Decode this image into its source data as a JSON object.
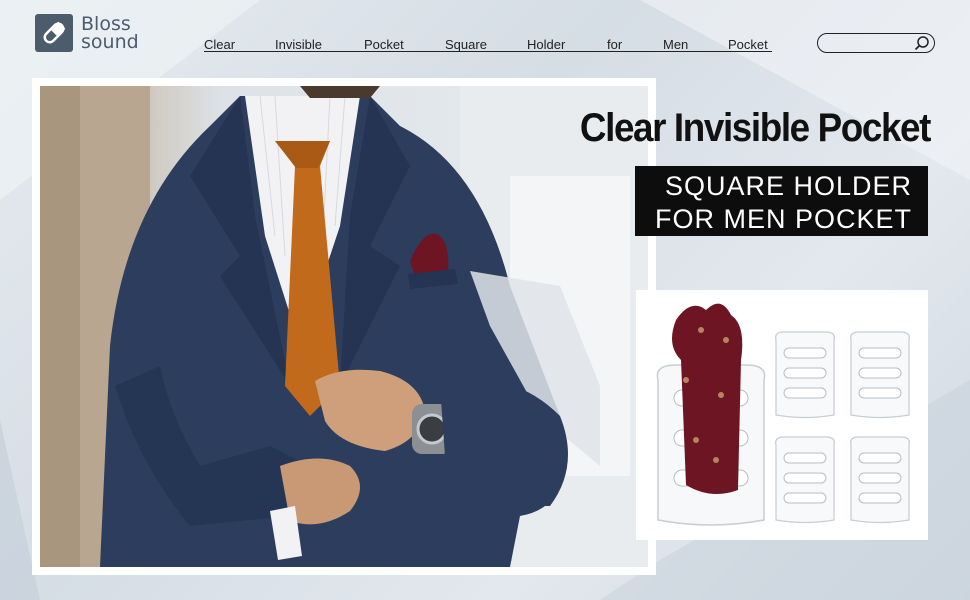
{
  "brand": {
    "line1": "Bloss",
    "line2": "sound",
    "color": "#4d5c6c"
  },
  "nav": {
    "items": [
      {
        "label": "Clear"
      },
      {
        "label": "Invisible"
      },
      {
        "label": "Pocket"
      },
      {
        "label": "Square"
      },
      {
        "label": "Holder"
      },
      {
        "label": "for"
      },
      {
        "label": "Men"
      },
      {
        "label": "Pocket"
      }
    ]
  },
  "search": {
    "placeholder": "",
    "icon": "search-icon"
  },
  "hero": {
    "headline": "Clear Invisible Pocket",
    "sub_line1": "SQUARE HOLDER",
    "sub_line2": "FOR MEN POCKET"
  },
  "colors": {
    "suit": "#2c3d5e",
    "tie": "#c26a1b",
    "pocket_square": "#6e1523",
    "headline_box": "#0d0d0d"
  }
}
